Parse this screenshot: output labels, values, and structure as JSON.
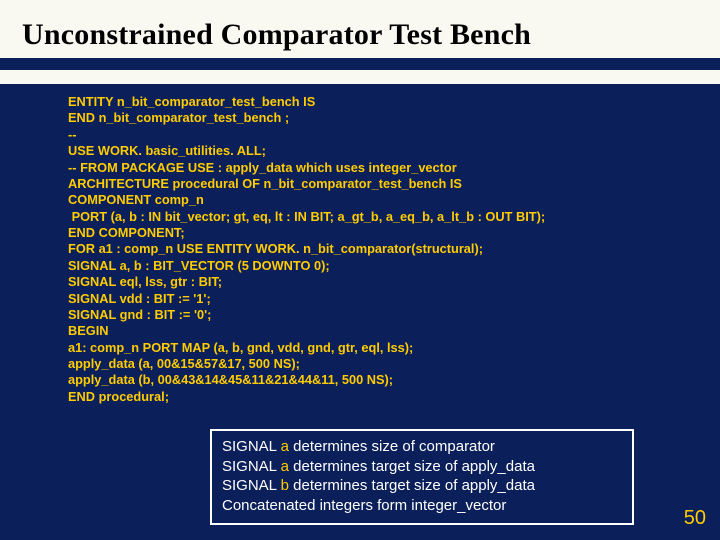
{
  "title": "Unconstrained Comparator Test Bench",
  "code": [
    "ENTITY n_bit_comparator_test_bench IS",
    "END n_bit_comparator_test_bench ;",
    "--",
    "USE WORK. basic_utilities. ALL;",
    "-- FROM PACKAGE USE : apply_data which uses integer_vector",
    "ARCHITECTURE procedural OF n_bit_comparator_test_bench IS",
    "COMPONENT comp_n",
    " PORT (a, b : IN bit_vector; gt, eq, lt : IN BIT; a_gt_b, a_eq_b, a_lt_b : OUT BIT);",
    "END COMPONENT;",
    "FOR a1 : comp_n USE ENTITY WORK. n_bit_comparator(structural);",
    "SIGNAL a, b : BIT_VECTOR (5 DOWNTO 0);",
    "SIGNAL eql, lss, gtr : BIT;",
    "SIGNAL vdd : BIT := '1';",
    "SIGNAL gnd : BIT := '0';",
    "BEGIN",
    "a1: comp_n PORT MAP (a, b, gnd, vdd, gnd, gtr, eql, lss);",
    "apply_data (a, 00&15&57&17, 500 NS);",
    "apply_data (b, 00&43&14&45&11&21&44&11, 500 NS);",
    "END procedural;"
  ],
  "callout": {
    "l1a": "SIGNAL ",
    "l1sig": "a",
    "l1b": " determines size of comparator",
    "l2a": "SIGNAL ",
    "l2sig": "a",
    "l2b": " determines target size of apply_data",
    "l3a": "SIGNAL ",
    "l3sig": "b",
    "l3b": " determines target size of apply_data",
    "l4": "Concatenated integers form integer_vector"
  },
  "page": "50"
}
